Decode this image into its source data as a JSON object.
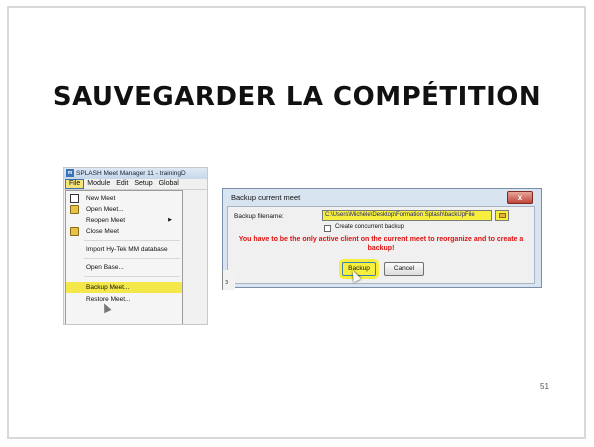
{
  "slide": {
    "title": "SAUVEGARDER LA COMPÉTITION",
    "page_number": "51"
  },
  "menu_screenshot": {
    "window_title": "SPLASH Meet Manager 11 - trainingD",
    "app_icon": "m",
    "menubar": [
      "File",
      "Module",
      "Edit",
      "Setup",
      "Global"
    ],
    "file_menu": {
      "new_meet": "New Meet",
      "open_meet": "Open Meet...",
      "reopen_meet": "Reopen Meet",
      "close_meet": "Close Meet",
      "import_hytek": "Import Hy-Tek MM database",
      "open_base": "Open Base...",
      "backup_meet": "Backup Meet...",
      "restore_meet": "Restore Meet..."
    },
    "highlight_color": "#f3e74a"
  },
  "dialog_screenshot": {
    "title": "Backup current meet",
    "close_glyph": "x",
    "filename_label": "Backup filename:",
    "filename_value": "C:\\Users\\Michèle\\Desktop\\Formation Splash\\backUpFile",
    "concurrent_label": "Create concurrent backup",
    "concurrent_checked": false,
    "warning": "You have to be the only active client on the current meet to reorganize and to create a backup!",
    "backup_button": "Backup",
    "cancel_button": "Cancel",
    "background_partial_text": "3",
    "warning_color": "#e01010",
    "highlight_color": "#f7ef3e"
  }
}
